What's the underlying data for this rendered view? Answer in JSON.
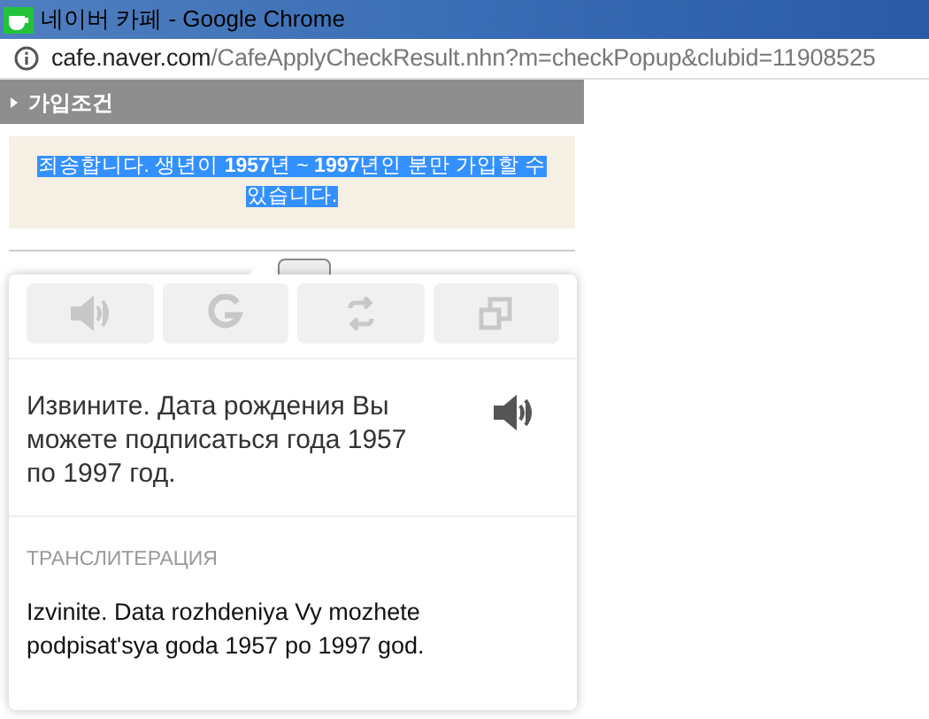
{
  "window": {
    "title": "네이버 카페 - Google Chrome"
  },
  "address_bar": {
    "domain": "cafe.naver.com",
    "path": "/CafeApplyCheckResult.nhn?m=checkPopup&clubid=11908525"
  },
  "section": {
    "title": "가입조건"
  },
  "message": {
    "text": "죄송합니다. 생년이 **1957**년 ~ **1997**년인 분만 가입할 수 있습니다.",
    "highlighted": true
  },
  "translate_popup": {
    "toolbar": [
      {
        "kind": "speaker"
      },
      {
        "kind": "google"
      },
      {
        "kind": "swap"
      },
      {
        "kind": "copy"
      }
    ],
    "translation": "Извините. Дата рождения Вы можете подписаться года 1957 по 1997 год.",
    "transliteration_label": "ТРАНСЛИТЕРАЦИЯ",
    "transliteration": "Izvinite. Data rozhdeniya Vy mozhete podpisat'sya goda 1957 po 1997 god."
  }
}
